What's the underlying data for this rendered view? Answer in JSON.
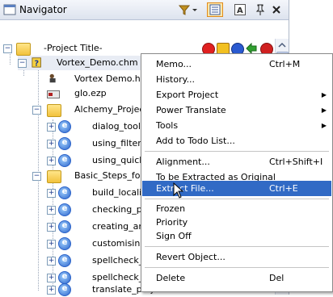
{
  "window": {
    "title": "Navigator"
  },
  "tree": {
    "root": "-Project Title-",
    "project": "Vortex_Demo.chm",
    "files": [
      "Vortex Demo.hhp",
      "glo.ezp"
    ],
    "alchemy": "Alchemy_Project",
    "alchemy_children": [
      "dialog_toolba",
      "using_filters",
      "using_quickfi"
    ],
    "basic": "Basic_Steps_for_",
    "basic_children": [
      "build_localize",
      "checking_pro",
      "creating_an_",
      "customising_",
      "spellcheck_t",
      "spellcheck_y",
      "translate_projects.htm"
    ]
  },
  "menu": {
    "items": [
      {
        "label": "Memo...",
        "shortcut": "Ctrl+M"
      },
      {
        "label": "History...",
        "shortcut": ""
      },
      {
        "label": "Export Project",
        "shortcut": "",
        "submenu": true
      },
      {
        "label": "Power Translate",
        "shortcut": "",
        "submenu": true
      },
      {
        "label": "Tools",
        "shortcut": "",
        "submenu": true
      },
      {
        "label": "Add to Todo List...",
        "shortcut": ""
      },
      {
        "label": "Alignment...",
        "shortcut": "Ctrl+Shift+I"
      },
      {
        "label": "To be Extracted as Original",
        "shortcut": ""
      },
      {
        "label": "Extract File...",
        "shortcut": "Ctrl+E",
        "highlighted": true
      },
      {
        "label": "Frozen",
        "shortcut": ""
      },
      {
        "label": "Priority",
        "shortcut": ""
      },
      {
        "label": "Sign Off",
        "shortcut": ""
      },
      {
        "label": "Revert Object...",
        "shortcut": ""
      },
      {
        "label": "Delete",
        "shortcut": "Del"
      }
    ]
  },
  "colors": {
    "highlight": "#316ac5",
    "panel_border": "#aeb8c8"
  }
}
